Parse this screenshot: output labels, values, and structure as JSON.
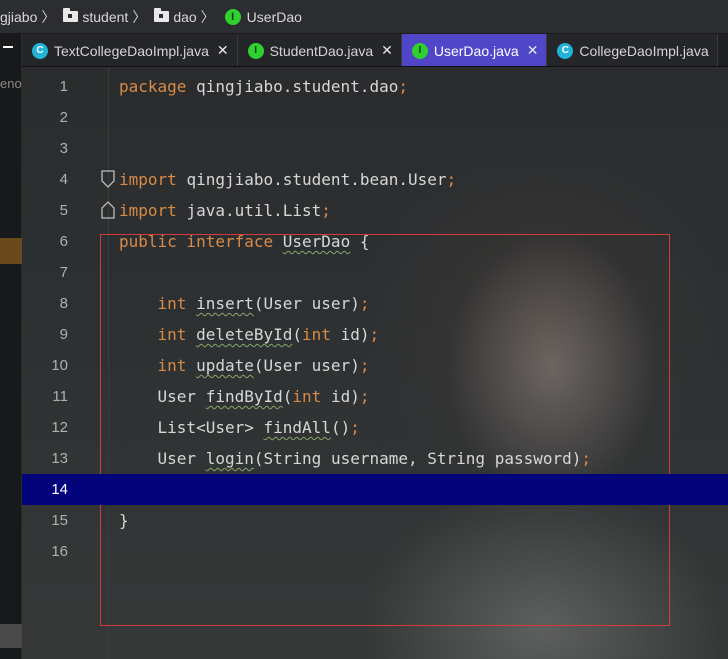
{
  "breadcrumb": {
    "items": [
      "gjiabo",
      "student",
      "dao",
      "UserDao"
    ],
    "interface_badge": "I"
  },
  "left_strip": {
    "cut_text": "enov"
  },
  "tabs": [
    {
      "label": "TextCollegeDaoImpl.java",
      "icon": "class-icon",
      "icon_letter": "C",
      "close": "✕",
      "active": false
    },
    {
      "label": "StudentDao.java",
      "icon": "interface-icon",
      "icon_letter": "I",
      "close": "✕",
      "active": false
    },
    {
      "label": "UserDao.java",
      "icon": "interface-icon",
      "icon_letter": "I",
      "close": "✕",
      "active": true
    },
    {
      "label": "CollegeDaoImpl.java",
      "icon": "class-icon",
      "icon_letter": "C",
      "close": "",
      "active": false
    }
  ],
  "editor": {
    "current_line": 14,
    "lines": [
      {
        "n": "1",
        "tokens": [
          [
            "kw",
            "package "
          ],
          [
            "pu",
            "qingjiabo.student.dao"
          ],
          [
            "semi",
            ";"
          ]
        ]
      },
      {
        "n": "2",
        "tokens": []
      },
      {
        "n": "3",
        "tokens": []
      },
      {
        "n": "4",
        "tokens": [
          [
            "kw",
            "import "
          ],
          [
            "pu",
            "qingjiabo.student.bean.User"
          ],
          [
            "semi",
            ";"
          ]
        ]
      },
      {
        "n": "5",
        "tokens": [
          [
            "kw",
            "import "
          ],
          [
            "pu",
            "java.util.List"
          ],
          [
            "semi",
            ";"
          ]
        ]
      },
      {
        "n": "6",
        "tokens": [
          [
            "kw",
            "public interface "
          ],
          [
            "fn",
            "UserDao"
          ],
          [
            "pu",
            " {"
          ]
        ]
      },
      {
        "n": "7",
        "tokens": []
      },
      {
        "n": "8",
        "tokens": [
          [
            "pu",
            "    "
          ],
          [
            "kw",
            "int "
          ],
          [
            "fn",
            "insert"
          ],
          [
            "pu",
            "(User user)"
          ],
          [
            "semi",
            ";"
          ]
        ]
      },
      {
        "n": "9",
        "tokens": [
          [
            "pu",
            "    "
          ],
          [
            "kw",
            "int "
          ],
          [
            "fn",
            "deleteById"
          ],
          [
            "pu",
            "("
          ],
          [
            "kw",
            "int "
          ],
          [
            "pu",
            "id)"
          ],
          [
            "semi",
            ";"
          ]
        ]
      },
      {
        "n": "10",
        "tokens": [
          [
            "pu",
            "    "
          ],
          [
            "kw",
            "int "
          ],
          [
            "fn",
            "update"
          ],
          [
            "pu",
            "(User user)"
          ],
          [
            "semi",
            ";"
          ]
        ]
      },
      {
        "n": "11",
        "tokens": [
          [
            "pu",
            "    User "
          ],
          [
            "fn",
            "findById"
          ],
          [
            "pu",
            "("
          ],
          [
            "kw",
            "int "
          ],
          [
            "pu",
            "id)"
          ],
          [
            "semi",
            ";"
          ]
        ]
      },
      {
        "n": "12",
        "tokens": [
          [
            "pu",
            "    List<User> "
          ],
          [
            "fn",
            "findAll"
          ],
          [
            "pu",
            "()"
          ],
          [
            "semi",
            ";"
          ]
        ]
      },
      {
        "n": "13",
        "tokens": [
          [
            "pu",
            "    User "
          ],
          [
            "fn",
            "login"
          ],
          [
            "pu",
            "(String username, String password)"
          ],
          [
            "semi",
            ";"
          ]
        ]
      },
      {
        "n": "14",
        "tokens": []
      },
      {
        "n": "15",
        "tokens": [
          [
            "pu",
            "}"
          ]
        ]
      },
      {
        "n": "16",
        "tokens": []
      }
    ]
  },
  "colors": {
    "keyword": "#d98a45",
    "current_line_bg": "#03037c",
    "active_tab_bg": "#4f46c8",
    "selection_border": "#d23b3b"
  }
}
